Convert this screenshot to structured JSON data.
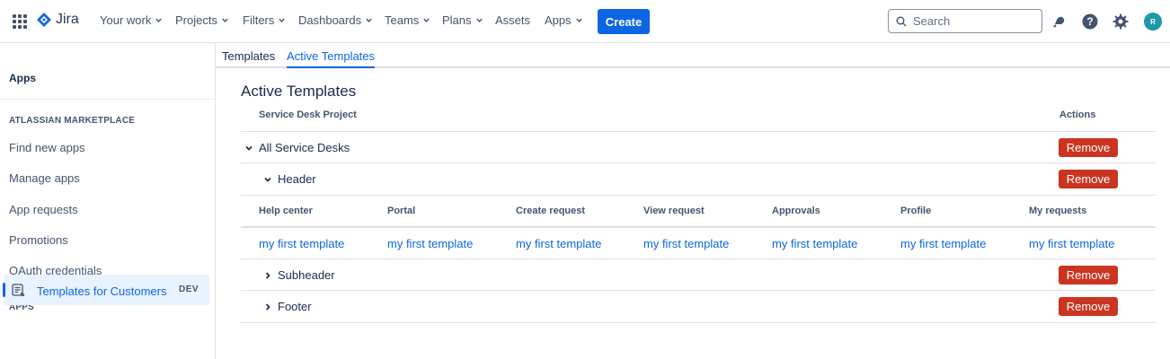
{
  "topnav": {
    "brand": "Jira",
    "items": [
      {
        "label": "Your work",
        "dropdown": true
      },
      {
        "label": "Projects",
        "dropdown": true
      },
      {
        "label": "Filters",
        "dropdown": true
      },
      {
        "label": "Dashboards",
        "dropdown": true
      },
      {
        "label": "Teams",
        "dropdown": true
      },
      {
        "label": "Plans",
        "dropdown": true
      },
      {
        "label": "Assets",
        "dropdown": false
      },
      {
        "label": "Apps",
        "dropdown": true
      }
    ],
    "create_label": "Create",
    "search_placeholder": "Search",
    "avatar_initial": "R",
    "icons": [
      "notifications-icon",
      "help-icon",
      "settings-icon"
    ]
  },
  "sidebar": {
    "title": "Apps",
    "marketplace_section": "ATLASSIAN MARKETPLACE",
    "marketplace_items": [
      "Find new apps",
      "Manage apps",
      "App requests",
      "Promotions",
      "OAuth credentials"
    ],
    "apps_section": "APPS",
    "active_item": {
      "label": "Templates for Customers",
      "badge": "DEV"
    }
  },
  "tabs": [
    {
      "label": "Templates",
      "active": false
    },
    {
      "label": "Active Templates",
      "active": true
    }
  ],
  "main": {
    "title": "Active Templates",
    "columns": {
      "project": "Service Desk Project",
      "actions": "Actions"
    },
    "rows": [
      {
        "label": "All Service Desks",
        "expanded": true,
        "action": "Remove"
      },
      {
        "label": "Header",
        "expanded": true,
        "action": "Remove"
      },
      {
        "label": "Subheader",
        "expanded": false,
        "action": "Remove"
      },
      {
        "label": "Footer",
        "expanded": false,
        "action": "Remove"
      }
    ],
    "sub_columns": [
      "Help center",
      "Portal",
      "Create request",
      "View request",
      "Approvals",
      "Profile",
      "My requests"
    ],
    "sub_values": [
      "my first template",
      "my first template",
      "my first template",
      "my first template",
      "my first template",
      "my first template",
      "my first template"
    ]
  },
  "colors": {
    "accent": "#0c66e4",
    "danger": "#ca3521",
    "text": "#172b4d",
    "subtle": "#44546f"
  }
}
